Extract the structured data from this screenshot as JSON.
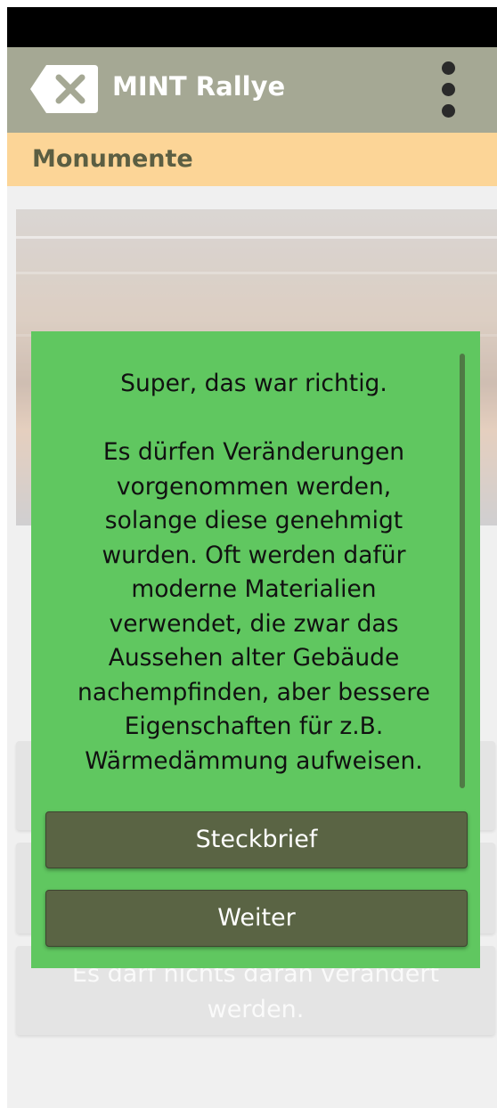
{
  "app_bar": {
    "title": "MINT Rallye",
    "back_icon": "close-icon",
    "menu_icon": "more-vertical-icon",
    "background_color": "#a5a894"
  },
  "section": {
    "title": "Monumente",
    "background_color": "#fcd597"
  },
  "answers": {
    "visible_partial_text": "Es darf nichts daran verändert werden."
  },
  "dialog": {
    "background_color": "#60c760",
    "feedback": "Super, das war richtig.",
    "explanation_lines": [
      "Es dürfen Veränderungen",
      "vorgenommen werden,",
      "solange diese genehmigt",
      "wurden. Oft werden dafür",
      "moderne Materialien",
      "verwendet, die zwar das",
      "Aussehen alter Gebäude",
      "nachempfinden, aber bessere",
      "Eigenschaften für z.B.",
      "Wärmedämmung aufweisen."
    ],
    "buttons": {
      "profile_label": "Steckbrief",
      "next_label": "Weiter"
    }
  }
}
